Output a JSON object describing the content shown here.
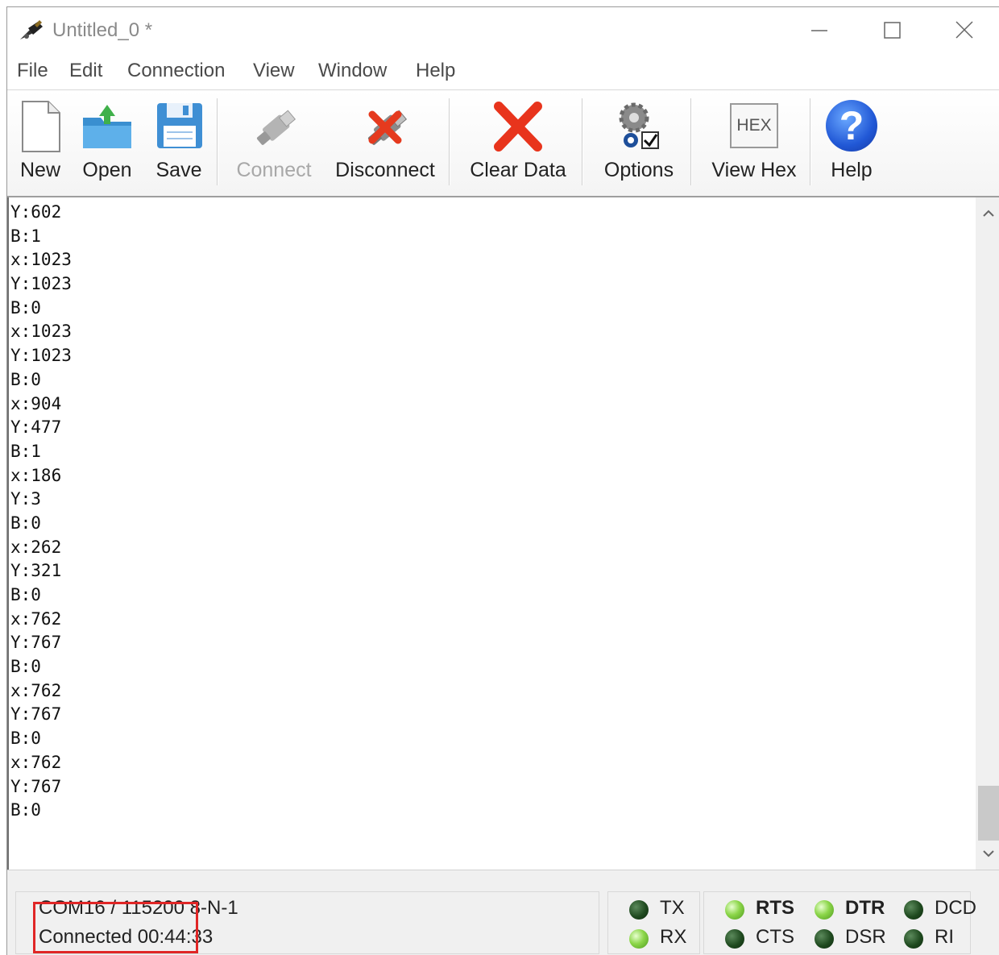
{
  "window": {
    "title": "Untitled_0 *"
  },
  "menu": [
    "File",
    "Edit",
    "Connection",
    "View",
    "Window",
    "Help"
  ],
  "toolbar": {
    "new": "New",
    "open": "Open",
    "save": "Save",
    "connect": "Connect",
    "disconnect": "Disconnect",
    "clear": "Clear Data",
    "options": "Options",
    "view_hex": "View Hex",
    "help": "Help",
    "hex_badge": "HEX",
    "help_glyph": "?"
  },
  "terminal": {
    "lines": [
      "Y:602",
      "B:1",
      "x:1023",
      "Y:1023",
      "B:0",
      "x:1023",
      "Y:1023",
      "B:0",
      "x:904",
      "Y:477",
      "B:1",
      "x:186",
      "Y:3",
      "B:0",
      "x:262",
      "Y:321",
      "B:0",
      "x:762",
      "Y:767",
      "B:0",
      "x:762",
      "Y:767",
      "B:0",
      "x:762",
      "Y:767",
      "B:0"
    ]
  },
  "status": {
    "port": "COM16 / 115200 8-N-1",
    "connection": "Connected 00:44:33",
    "signals": {
      "tx": "TX",
      "rx": "RX",
      "rts": "RTS",
      "cts": "CTS",
      "dtr": "DTR",
      "dsr": "DSR",
      "dcd": "DCD",
      "ri": "RI"
    }
  },
  "colors": {
    "highlight": "#e02626",
    "led_on": "#8cd64a",
    "led_off": "#1f4a1f"
  }
}
